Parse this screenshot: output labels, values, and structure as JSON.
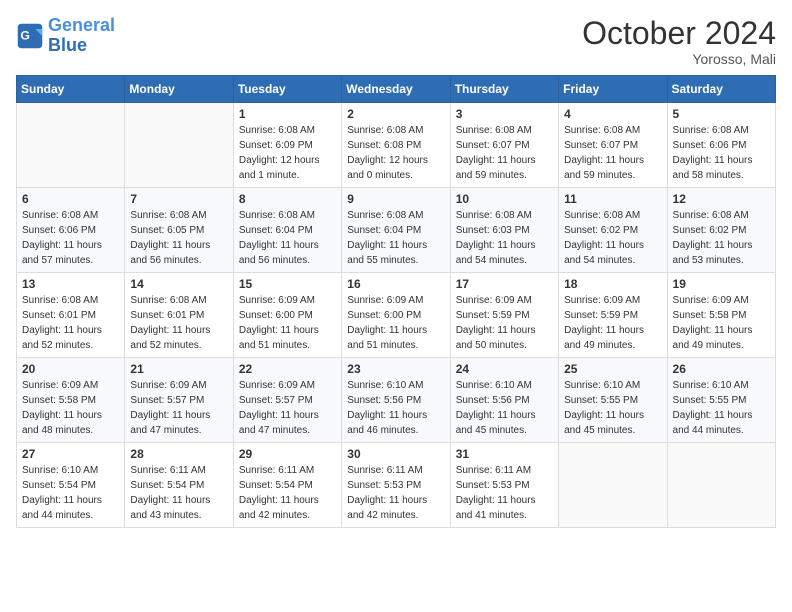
{
  "logo": {
    "line1": "General",
    "line2": "Blue"
  },
  "title": "October 2024",
  "subtitle": "Yorosso, Mali",
  "weekdays": [
    "Sunday",
    "Monday",
    "Tuesday",
    "Wednesday",
    "Thursday",
    "Friday",
    "Saturday"
  ],
  "weeks": [
    [
      {
        "day": "",
        "info": ""
      },
      {
        "day": "",
        "info": ""
      },
      {
        "day": "1",
        "info": "Sunrise: 6:08 AM\nSunset: 6:09 PM\nDaylight: 12 hours\nand 1 minute."
      },
      {
        "day": "2",
        "info": "Sunrise: 6:08 AM\nSunset: 6:08 PM\nDaylight: 12 hours\nand 0 minutes."
      },
      {
        "day": "3",
        "info": "Sunrise: 6:08 AM\nSunset: 6:07 PM\nDaylight: 11 hours\nand 59 minutes."
      },
      {
        "day": "4",
        "info": "Sunrise: 6:08 AM\nSunset: 6:07 PM\nDaylight: 11 hours\nand 59 minutes."
      },
      {
        "day": "5",
        "info": "Sunrise: 6:08 AM\nSunset: 6:06 PM\nDaylight: 11 hours\nand 58 minutes."
      }
    ],
    [
      {
        "day": "6",
        "info": "Sunrise: 6:08 AM\nSunset: 6:06 PM\nDaylight: 11 hours\nand 57 minutes."
      },
      {
        "day": "7",
        "info": "Sunrise: 6:08 AM\nSunset: 6:05 PM\nDaylight: 11 hours\nand 56 minutes."
      },
      {
        "day": "8",
        "info": "Sunrise: 6:08 AM\nSunset: 6:04 PM\nDaylight: 11 hours\nand 56 minutes."
      },
      {
        "day": "9",
        "info": "Sunrise: 6:08 AM\nSunset: 6:04 PM\nDaylight: 11 hours\nand 55 minutes."
      },
      {
        "day": "10",
        "info": "Sunrise: 6:08 AM\nSunset: 6:03 PM\nDaylight: 11 hours\nand 54 minutes."
      },
      {
        "day": "11",
        "info": "Sunrise: 6:08 AM\nSunset: 6:02 PM\nDaylight: 11 hours\nand 54 minutes."
      },
      {
        "day": "12",
        "info": "Sunrise: 6:08 AM\nSunset: 6:02 PM\nDaylight: 11 hours\nand 53 minutes."
      }
    ],
    [
      {
        "day": "13",
        "info": "Sunrise: 6:08 AM\nSunset: 6:01 PM\nDaylight: 11 hours\nand 52 minutes."
      },
      {
        "day": "14",
        "info": "Sunrise: 6:08 AM\nSunset: 6:01 PM\nDaylight: 11 hours\nand 52 minutes."
      },
      {
        "day": "15",
        "info": "Sunrise: 6:09 AM\nSunset: 6:00 PM\nDaylight: 11 hours\nand 51 minutes."
      },
      {
        "day": "16",
        "info": "Sunrise: 6:09 AM\nSunset: 6:00 PM\nDaylight: 11 hours\nand 51 minutes."
      },
      {
        "day": "17",
        "info": "Sunrise: 6:09 AM\nSunset: 5:59 PM\nDaylight: 11 hours\nand 50 minutes."
      },
      {
        "day": "18",
        "info": "Sunrise: 6:09 AM\nSunset: 5:59 PM\nDaylight: 11 hours\nand 49 minutes."
      },
      {
        "day": "19",
        "info": "Sunrise: 6:09 AM\nSunset: 5:58 PM\nDaylight: 11 hours\nand 49 minutes."
      }
    ],
    [
      {
        "day": "20",
        "info": "Sunrise: 6:09 AM\nSunset: 5:58 PM\nDaylight: 11 hours\nand 48 minutes."
      },
      {
        "day": "21",
        "info": "Sunrise: 6:09 AM\nSunset: 5:57 PM\nDaylight: 11 hours\nand 47 minutes."
      },
      {
        "day": "22",
        "info": "Sunrise: 6:09 AM\nSunset: 5:57 PM\nDaylight: 11 hours\nand 47 minutes."
      },
      {
        "day": "23",
        "info": "Sunrise: 6:10 AM\nSunset: 5:56 PM\nDaylight: 11 hours\nand 46 minutes."
      },
      {
        "day": "24",
        "info": "Sunrise: 6:10 AM\nSunset: 5:56 PM\nDaylight: 11 hours\nand 45 minutes."
      },
      {
        "day": "25",
        "info": "Sunrise: 6:10 AM\nSunset: 5:55 PM\nDaylight: 11 hours\nand 45 minutes."
      },
      {
        "day": "26",
        "info": "Sunrise: 6:10 AM\nSunset: 5:55 PM\nDaylight: 11 hours\nand 44 minutes."
      }
    ],
    [
      {
        "day": "27",
        "info": "Sunrise: 6:10 AM\nSunset: 5:54 PM\nDaylight: 11 hours\nand 44 minutes."
      },
      {
        "day": "28",
        "info": "Sunrise: 6:11 AM\nSunset: 5:54 PM\nDaylight: 11 hours\nand 43 minutes."
      },
      {
        "day": "29",
        "info": "Sunrise: 6:11 AM\nSunset: 5:54 PM\nDaylight: 11 hours\nand 42 minutes."
      },
      {
        "day": "30",
        "info": "Sunrise: 6:11 AM\nSunset: 5:53 PM\nDaylight: 11 hours\nand 42 minutes."
      },
      {
        "day": "31",
        "info": "Sunrise: 6:11 AM\nSunset: 5:53 PM\nDaylight: 11 hours\nand 41 minutes."
      },
      {
        "day": "",
        "info": ""
      },
      {
        "day": "",
        "info": ""
      }
    ]
  ]
}
